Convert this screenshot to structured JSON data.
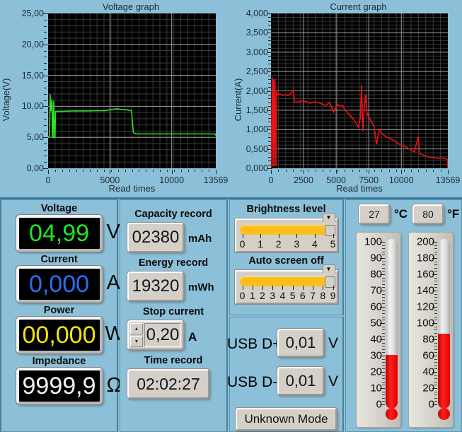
{
  "voltage_graph": {
    "title": "Voltage graph",
    "ylabel": "Voltage(V)",
    "xlabel": "Read times",
    "yticks": [
      "0,00",
      "5,00",
      "10,00",
      "15,00",
      "20,00",
      "25,00"
    ],
    "xticks": [
      "0",
      "5000",
      "10000",
      "13569"
    ]
  },
  "current_graph": {
    "title": "Current graph",
    "ylabel": "Current(A)",
    "xlabel": "Read times",
    "yticks": [
      "0,000",
      "0,500",
      "1,000",
      "1,500",
      "2,000",
      "2,500",
      "3,000",
      "3,500",
      "4,000"
    ],
    "xticks": [
      "0",
      "2500",
      "5000",
      "7500",
      "10000",
      "13569"
    ]
  },
  "chart_data": [
    {
      "type": "line",
      "title": "Voltage graph",
      "xlabel": "Read times",
      "ylabel": "Voltage(V)",
      "xlim": [
        0,
        13569
      ],
      "ylim": [
        0,
        25
      ],
      "grid": true,
      "line_color": "#2fe02f",
      "series": [
        {
          "name": "Voltage(V)",
          "x": [
            0,
            120,
            160,
            200,
            230,
            260,
            290,
            320,
            350,
            400,
            430,
            470,
            520,
            560,
            600,
            640,
            700,
            1000,
            2000,
            3000,
            4000,
            4600,
            5000,
            5400,
            5600,
            5900,
            6200,
            6500,
            6750,
            6820,
            6900,
            7000,
            7200,
            8000,
            9000,
            10000,
            11000,
            12000,
            13000,
            13500,
            13569
          ],
          "y": [
            5.1,
            5.1,
            12.0,
            9.2,
            10.6,
            9.3,
            11.1,
            9.2,
            5.1,
            5.0,
            10.9,
            9.3,
            5.0,
            5.0,
            9.2,
            9.2,
            9.2,
            9.2,
            9.25,
            9.25,
            9.3,
            9.3,
            9.45,
            9.55,
            9.6,
            9.5,
            9.45,
            9.4,
            9.3,
            7.5,
            5.8,
            5.6,
            5.55,
            5.55,
            5.55,
            5.55,
            5.55,
            5.55,
            5.55,
            5.55,
            5.3
          ]
        }
      ]
    },
    {
      "type": "line",
      "title": "Current graph",
      "xlabel": "Read times",
      "ylabel": "Current(A)",
      "xlim": [
        0,
        13569
      ],
      "ylim": [
        0,
        4.0
      ],
      "grid": true,
      "line_color": "#ee1111",
      "series": [
        {
          "name": "Current(A)",
          "x": [
            0,
            100,
            150,
            200,
            250,
            300,
            340,
            380,
            420,
            470,
            520,
            600,
            700,
            900,
            1100,
            1300,
            1500,
            1700,
            1800,
            1900,
            2100,
            2400,
            2700,
            3000,
            3300,
            3600,
            3900,
            4200,
            4500,
            4800,
            5100,
            5300,
            5500,
            5700,
            5900,
            6100,
            6300,
            6500,
            6700,
            6850,
            6950,
            7050,
            7150,
            7250,
            7350,
            7450,
            7550,
            7700,
            7900,
            8100,
            8300,
            8500,
            8700,
            8900,
            9100,
            9400,
            9700,
            10000,
            10300,
            10600,
            11000,
            11300,
            11400,
            11700,
            12000,
            12400,
            12800,
            13100,
            13400,
            13550,
            13569
          ],
          "y": [
            0.0,
            2.35,
            0.05,
            2.3,
            0.05,
            2.3,
            1.2,
            0.05,
            2.0,
            1.95,
            1.9,
            1.9,
            1.92,
            1.88,
            1.9,
            1.88,
            1.92,
            2.03,
            1.72,
            1.7,
            1.72,
            1.74,
            1.72,
            1.68,
            1.72,
            1.7,
            1.66,
            1.62,
            1.7,
            1.45,
            1.65,
            1.6,
            1.62,
            1.5,
            1.42,
            1.35,
            1.28,
            1.18,
            1.06,
            1.3,
            2.15,
            0.95,
            1.55,
            1.9,
            1.45,
            1.35,
            1.3,
            1.2,
            1.1,
            0.62,
            1.0,
            0.9,
            0.85,
            0.8,
            0.78,
            0.72,
            0.65,
            0.6,
            0.56,
            0.5,
            0.42,
            0.82,
            0.38,
            0.34,
            0.3,
            0.28,
            0.26,
            0.27,
            0.25,
            0.22,
            0.0
          ]
        }
      ]
    }
  ],
  "readouts": {
    "voltage": {
      "label": "Voltage",
      "value": "04,99",
      "unit": "V",
      "color": "#22e422"
    },
    "current": {
      "label": "Current",
      "value": "0,000",
      "unit": "A",
      "color": "#2b6ef5"
    },
    "power": {
      "label": "Power",
      "value": "00,000",
      "unit": "W",
      "color": "#f2e60a"
    },
    "impedance": {
      "label": "Impedance",
      "value": "9999,9",
      "unit": "Ω",
      "color": "#f2f2f2"
    }
  },
  "records": {
    "capacity": {
      "label": "Capacity record",
      "value": "02380",
      "unit": "mAh"
    },
    "energy": {
      "label": "Energy record",
      "value": "19320",
      "unit": "mWh"
    },
    "stop_current": {
      "label": "Stop current",
      "value": "0,20",
      "unit": "A",
      "up": "▲",
      "down": "▼"
    },
    "time": {
      "label": "Time record",
      "value": "02:02:27"
    }
  },
  "settings": {
    "brightness": {
      "label": "Brightness level",
      "value": 5,
      "min": 0,
      "max": 5,
      "ticks": [
        "0",
        "1",
        "2",
        "3",
        "4",
        "5"
      ]
    },
    "auto_screen_off": {
      "label": "Auto screen off",
      "value": 9,
      "min": 0,
      "max": 9,
      "ticks": [
        "0",
        "1",
        "2",
        "3",
        "4",
        "5",
        "6",
        "7",
        "8",
        "9"
      ]
    }
  },
  "usb": {
    "dplus": {
      "label": "USB D+",
      "value": "0,01",
      "unit": "V"
    },
    "dminus": {
      "label": "USB D-",
      "value": "0,01",
      "unit": "V"
    },
    "mode_button": "Unknown Mode"
  },
  "temperature": {
    "celsius": {
      "value": "27",
      "unit": "°C",
      "max": 100,
      "ticks": [
        "100",
        "90",
        "80",
        "70",
        "60",
        "50",
        "40",
        "30",
        "20",
        "10",
        "0"
      ]
    },
    "fahrenheit": {
      "value": "80",
      "unit": "°F",
      "max": 200,
      "ticks": [
        "200",
        "180",
        "160",
        "140",
        "120",
        "100",
        "80",
        "60",
        "40",
        "20",
        "0"
      ]
    }
  }
}
